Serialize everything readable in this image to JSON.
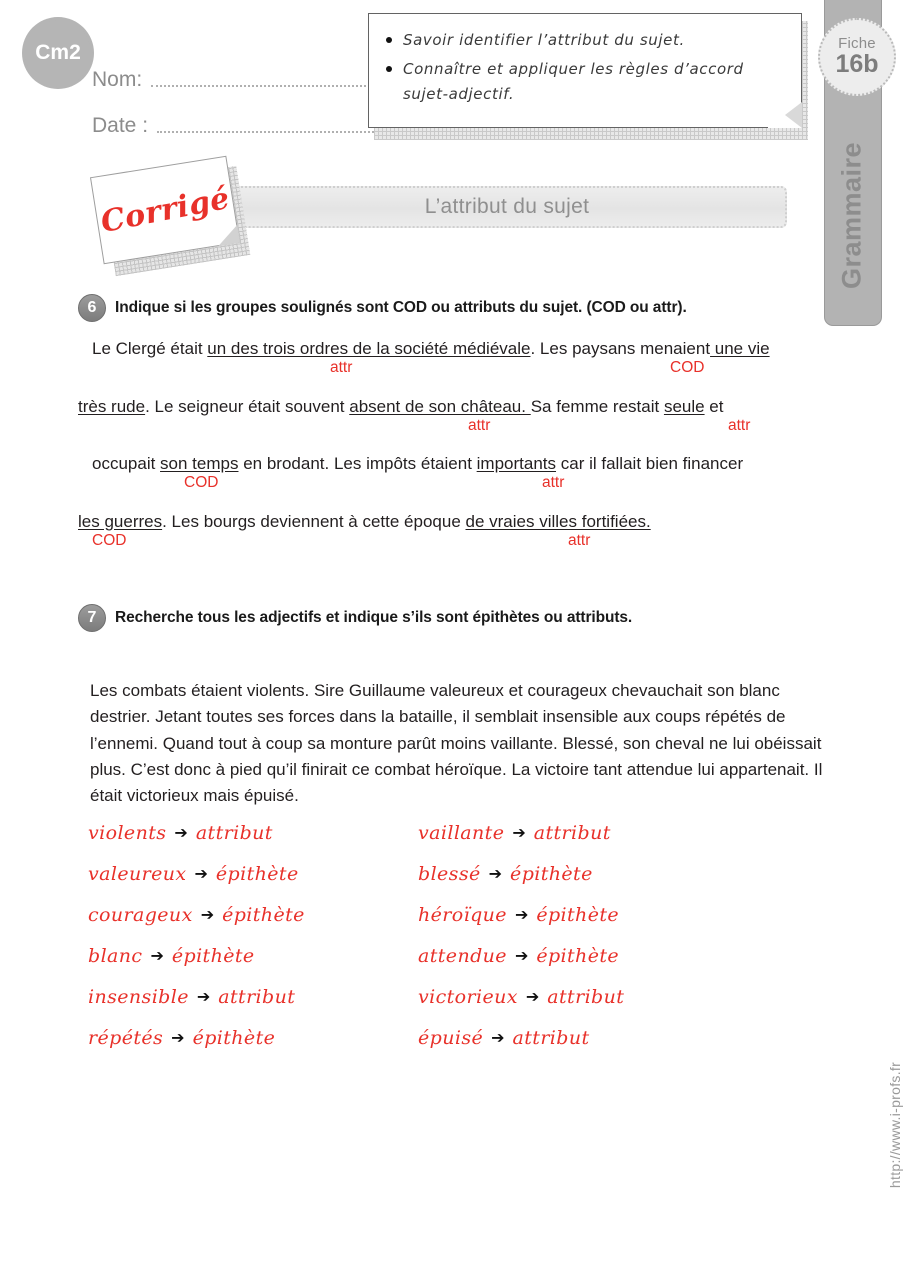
{
  "level_badge": "Cm2",
  "sidebar": {
    "fiche_word": "Fiche",
    "fiche_number": "16b",
    "subject": "Grammaire"
  },
  "identity": {
    "name_label": "Nom:",
    "date_label": "Date :"
  },
  "objectives": [
    "Savoir identifier l’attribut du sujet.",
    "Connaître et appliquer les règles d’accord sujet-adjectif."
  ],
  "stamp": "Corrigé",
  "title": "L’attribut du sujet",
  "exercise6": {
    "number": "6",
    "instruction": "Indique si les groupes soulignés sont COD ou attributs du sujet. (COD ou attr).",
    "lines": [
      {
        "before": "Le Clergé était ",
        "underlined": "un des trois ordres de la société médiévale",
        "middle": ". Les paysans menaient",
        "underlined2": " une vie",
        "label1": "attr",
        "label2": "COD"
      },
      {
        "before": "",
        "underlined": "très rude",
        "middle": ".  Le seigneur était souvent ",
        "underlined2": "absent de son château. ",
        "after": " Sa femme restait ",
        "underlined3": "seule",
        "tail": " et",
        "label1": "attr",
        "label2": "attr"
      },
      {
        "before": "occupait ",
        "underlined": "son temps",
        "middle": " en brodant. Les impôts étaient ",
        "underlined2": "importants",
        "after": " car il fallait bien financer",
        "label1": "COD",
        "label2": "attr"
      },
      {
        "before": "",
        "underlined": "les guerres",
        "middle": ". Les bourgs deviennent à cette époque ",
        "underlined2": "de vraies villes fortifiées.",
        "label1": "COD",
        "label2": "attr"
      }
    ]
  },
  "exercise7": {
    "number": "7",
    "instruction": "Recherche tous les adjectifs et indique s’ils sont épithètes ou attributs.",
    "paragraph": "Les combats étaient violents. Sire Guillaume valeureux et courageux chevauchait son blanc destrier. Jetant toutes ses forces dans la bataille, il semblait insensible aux coups répétés de l’ennemi. Quand tout à coup sa monture parût moins vaillante. Blessé, son cheval ne lui obéissait plus. C’est donc à pied qu’il finirait ce combat héroïque. La victoire tant attendue lui appartenait. Il était victorieux mais épuisé.",
    "arrow": "➔",
    "answers": [
      {
        "word": "violents",
        "kind": "attribut"
      },
      {
        "word": "vaillante",
        "kind": "attribut"
      },
      {
        "word": "valeureux",
        "kind": "épithète"
      },
      {
        "word": "blessé",
        "kind": "épithète"
      },
      {
        "word": "courageux",
        "kind": "épithète"
      },
      {
        "word": "héroïque",
        "kind": "épithète"
      },
      {
        "word": "blanc",
        "kind": "épithète"
      },
      {
        "word": "attendue",
        "kind": "épithète"
      },
      {
        "word": "insensible",
        "kind": "attribut"
      },
      {
        "word": "victorieux",
        "kind": "attribut"
      },
      {
        "word": "répétés",
        "kind": "épithète"
      },
      {
        "word": "épuisé",
        "kind": "attribut"
      }
    ]
  },
  "footer_url": "http://www.i-profs.fr",
  "colors": {
    "red": "#e8312a",
    "gray": "#b3b3b3",
    "text": "#231f20"
  }
}
